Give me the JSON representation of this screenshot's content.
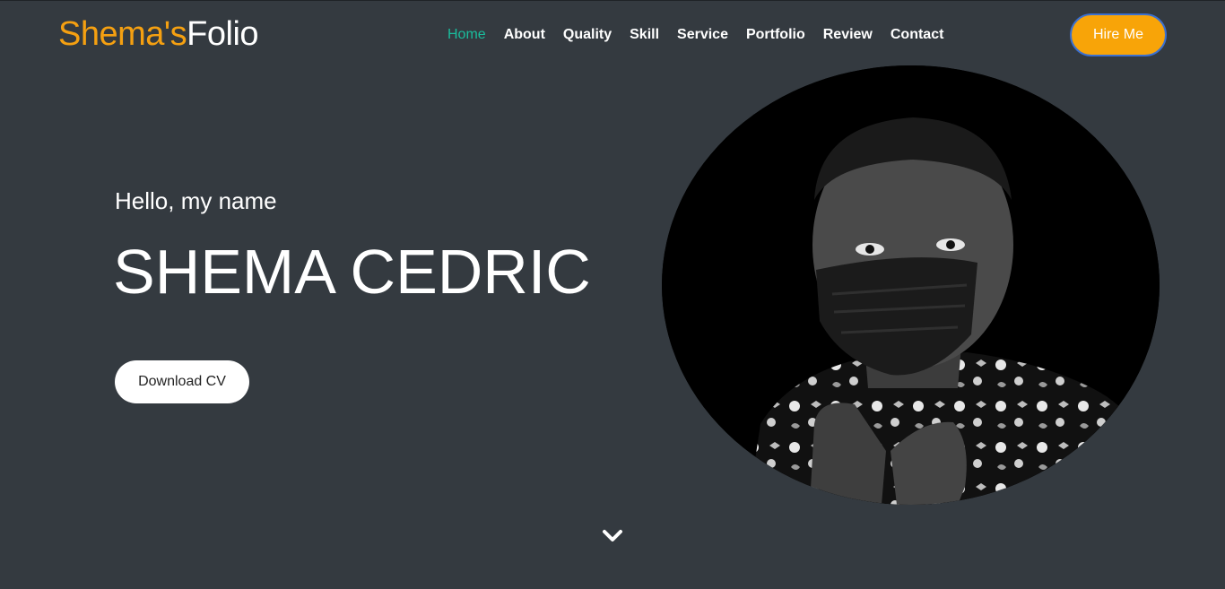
{
  "brand": {
    "part1": "Shema's",
    "part2": "Folio"
  },
  "nav": [
    {
      "label": "Home",
      "active": true
    },
    {
      "label": "About"
    },
    {
      "label": "Quality"
    },
    {
      "label": "Skill"
    },
    {
      "label": "Service"
    },
    {
      "label": "Portfolio"
    },
    {
      "label": "Review"
    },
    {
      "label": "Contact"
    }
  ],
  "hire_label": "Hire Me",
  "hero": {
    "greeting": "Hello, my name",
    "name": "SHEMA CEDRIC",
    "cv_label": "Download CV"
  },
  "icons": {
    "scroll": "chevron-down-icon"
  },
  "colors": {
    "background": "#343a40",
    "brand_accent": "#f5a011",
    "nav_active": "#1abc9c",
    "hire_button": "#f8a408"
  }
}
